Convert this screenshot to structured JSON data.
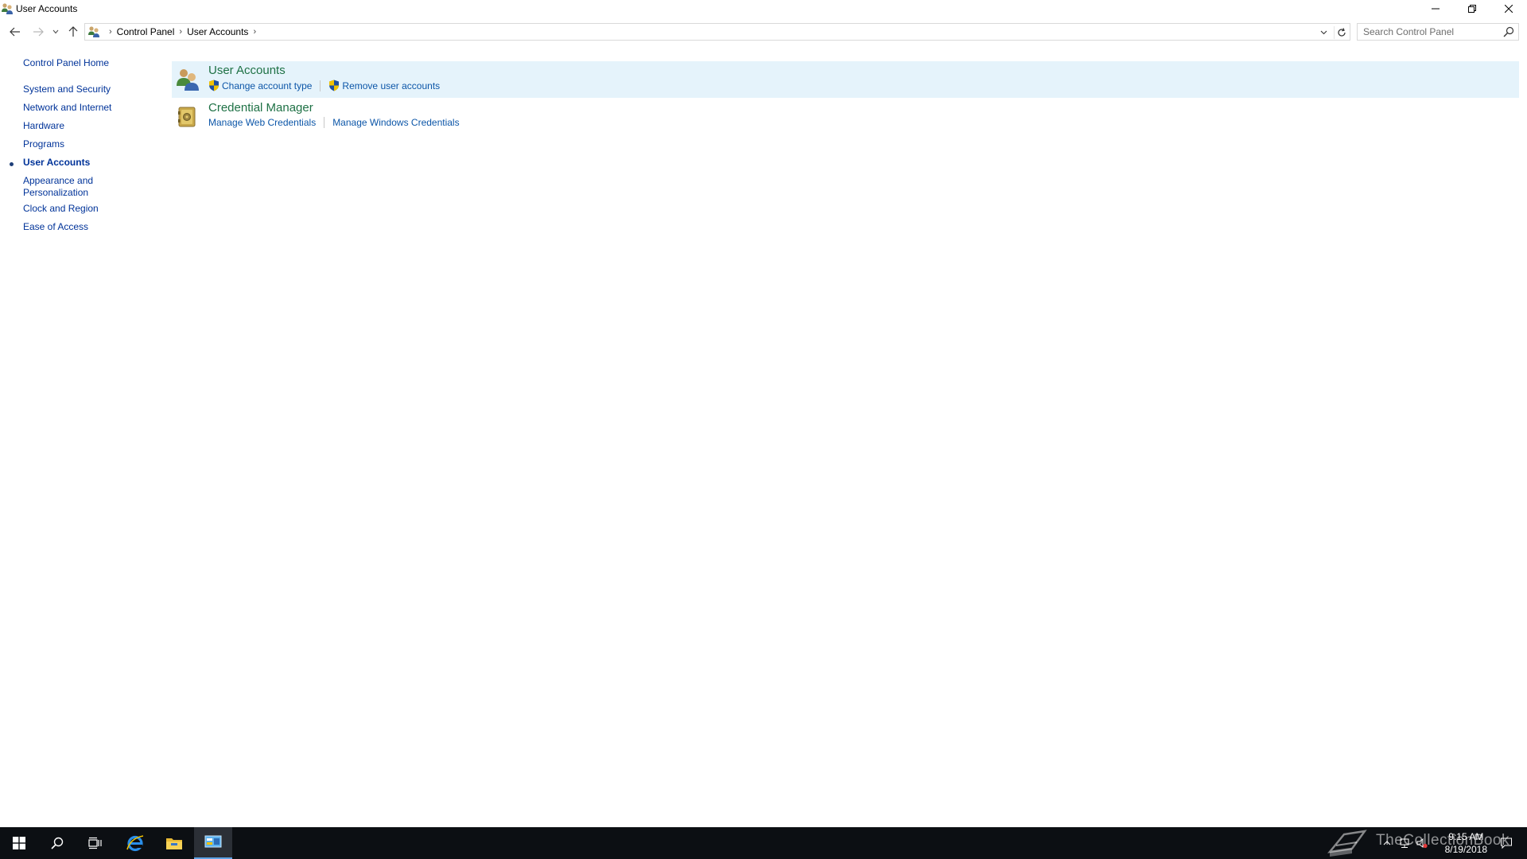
{
  "window": {
    "title": "User Accounts",
    "controls": [
      "minimize-icon",
      "restore-icon",
      "close-icon"
    ]
  },
  "address": {
    "breadcrumbs": [
      "Control Panel",
      "User Accounts"
    ],
    "search_placeholder": "Search Control Panel"
  },
  "leftnav": {
    "home": "Control Panel Home",
    "items": [
      {
        "label": "System and Security",
        "active": false
      },
      {
        "label": "Network and Internet",
        "active": false
      },
      {
        "label": "Hardware",
        "active": false
      },
      {
        "label": "Programs",
        "active": false
      },
      {
        "label": "User Accounts",
        "active": true
      },
      {
        "label_line1": "Appearance and",
        "label_line2": "Personalization",
        "active": false
      },
      {
        "label": "Clock and Region",
        "active": false
      },
      {
        "label": "Ease of Access",
        "active": false
      }
    ]
  },
  "main": {
    "categories": [
      {
        "title": "User Accounts",
        "icon": "users-icon",
        "links": [
          "Change account type",
          "Remove user accounts"
        ]
      },
      {
        "title": "Credential Manager",
        "icon": "credential-vault-icon",
        "links": [
          "Manage Web Credentials",
          "Manage Windows Credentials"
        ]
      }
    ]
  },
  "taskbar": {
    "apps": [
      "windows-start-icon",
      "search-icon",
      "task-view-icon",
      "internet-explorer-icon",
      "file-explorer-icon",
      "control-panel-icon"
    ],
    "watermark": "TheCollectionBook",
    "time": "9:15 AM",
    "date": "8/19/2018"
  },
  "colors": {
    "link": "#003399",
    "category_title": "#1e7145",
    "highlight": "#e5f3fb",
    "taskbar": "#0c0f13"
  }
}
